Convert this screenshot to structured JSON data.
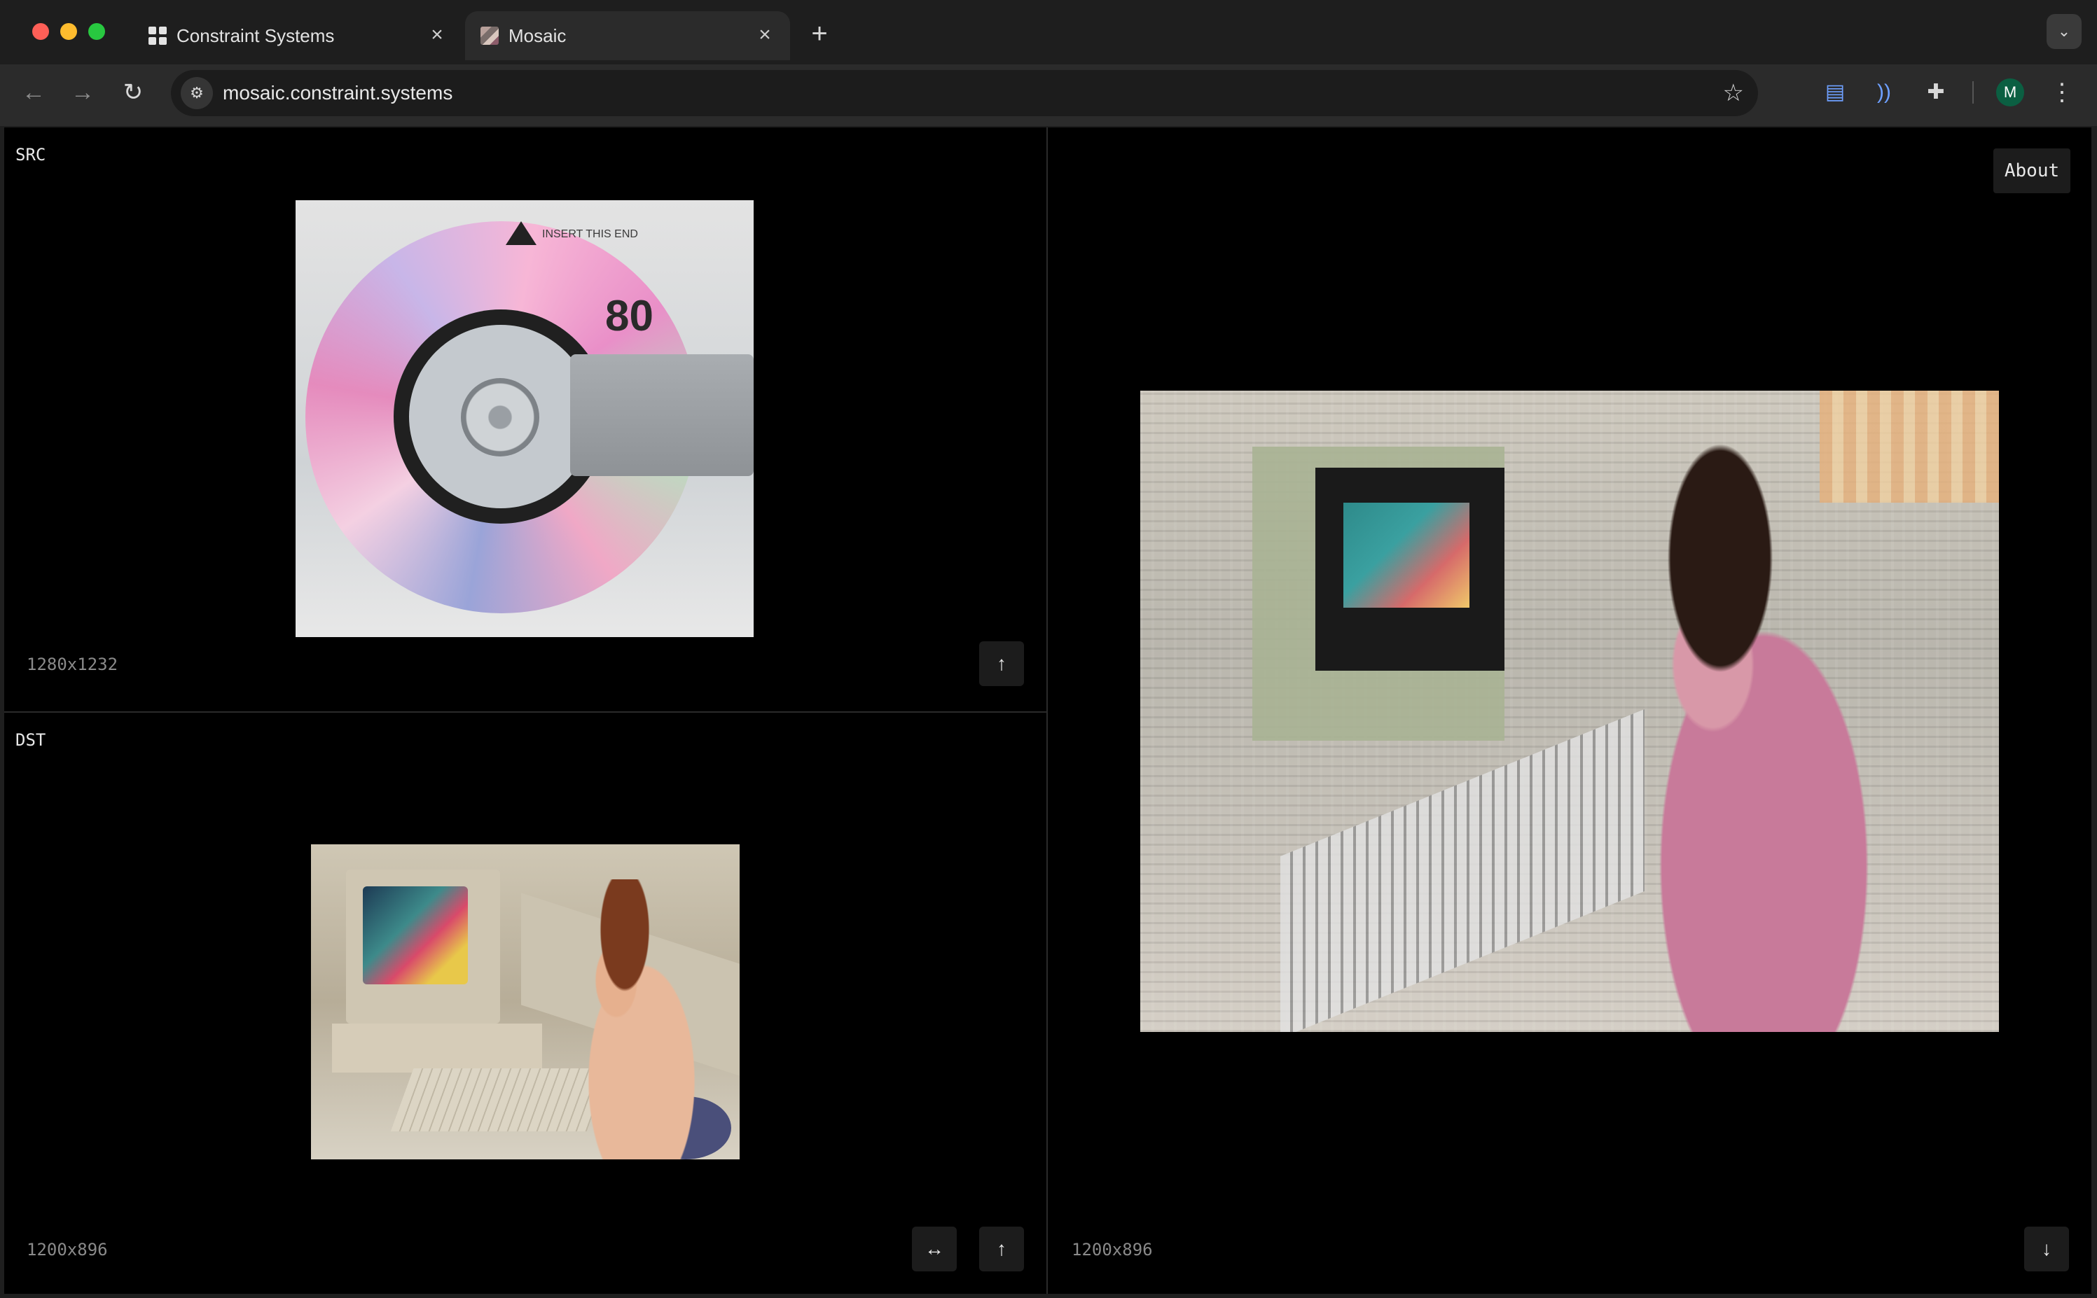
{
  "browser": {
    "tabs": [
      {
        "title": "Constraint Systems",
        "active": false
      },
      {
        "title": "Mosaic",
        "active": true
      }
    ],
    "tab_close_glyph": "×",
    "new_tab_glyph": "+",
    "tab_menu_glyph": "⌄",
    "url": "mosaic.constraint.systems",
    "profile_initial": "M",
    "icons": {
      "back": "←",
      "forward": "→",
      "reload": "↻",
      "site_info": "⚙",
      "star": "☆",
      "doc_ext": "▤",
      "wave_ext": "))",
      "puzzle_ext": "✚",
      "menu": "⋮"
    },
    "colors": {
      "profile_bg": "#0b5f42",
      "accent_ext": "#6ea0ff"
    }
  },
  "app": {
    "about_label": "About",
    "src": {
      "label": "SRC",
      "dims": "1280x1232",
      "upload_glyph": "↑"
    },
    "dst": {
      "label": "DST",
      "dims": "1200x896",
      "swap_glyph": "↔",
      "upload_glyph": "↑"
    },
    "out": {
      "dims": "1200x896",
      "download_glyph": "↓"
    },
    "src_image_text": {
      "number": "80",
      "insert": "INSERT THIS END"
    }
  }
}
